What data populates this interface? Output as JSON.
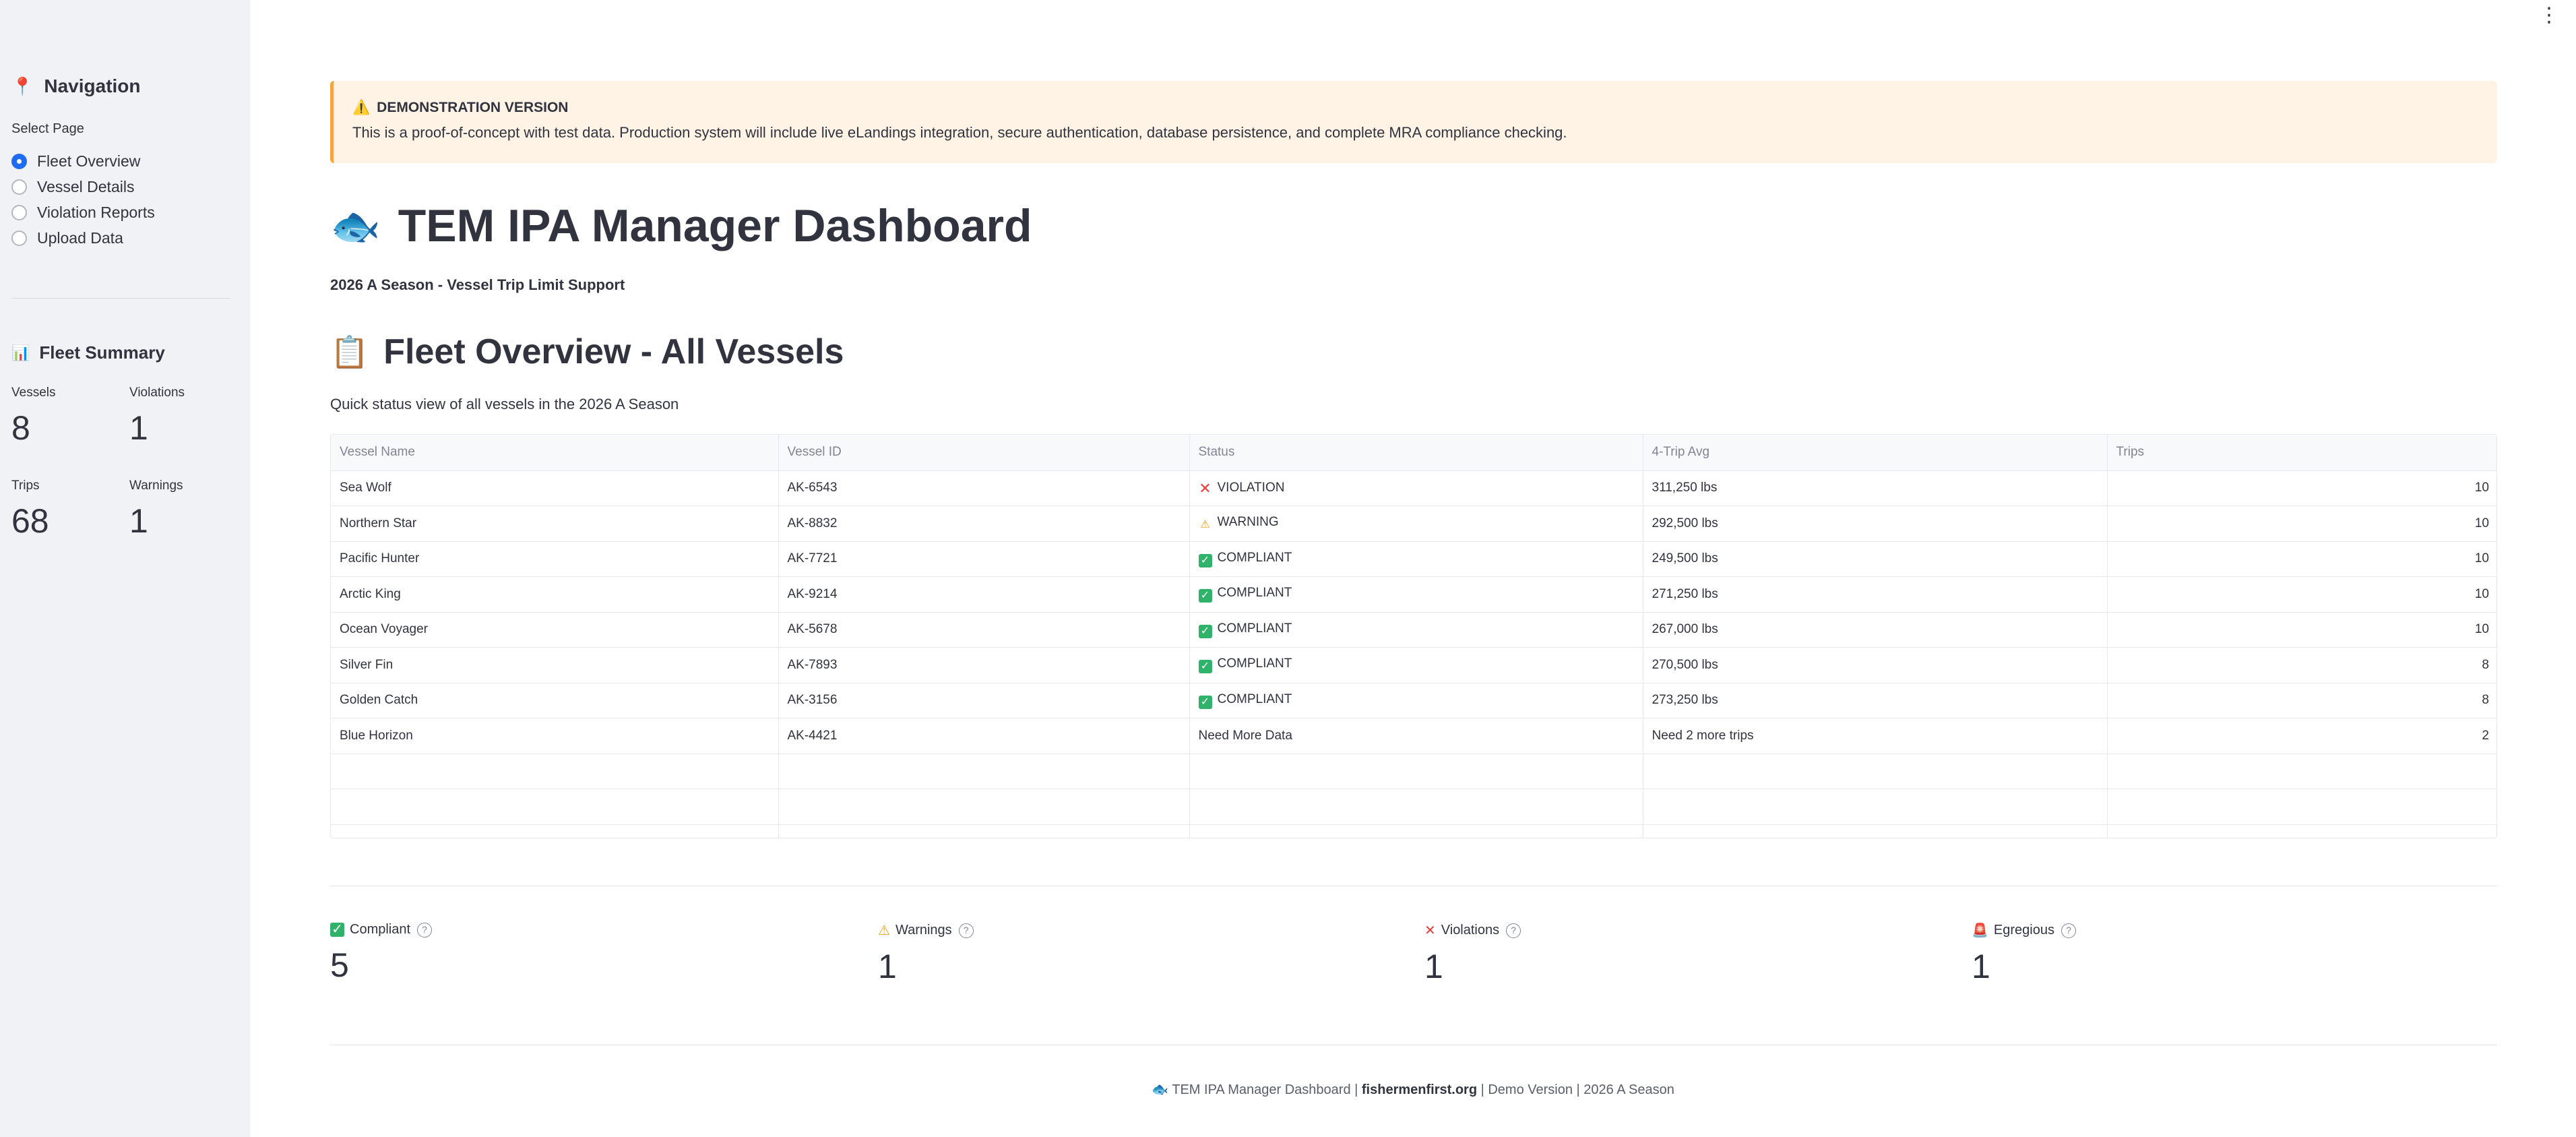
{
  "sidebar": {
    "nav_heading": "Navigation",
    "nav_icon": "pin-icon",
    "select_label": "Select Page",
    "pages": [
      {
        "label": "Fleet Overview",
        "selected": true
      },
      {
        "label": "Vessel Details",
        "selected": false
      },
      {
        "label": "Violation Reports",
        "selected": false
      },
      {
        "label": "Upload Data",
        "selected": false
      }
    ],
    "summary_heading": "Fleet Summary",
    "summary_icon": "bar-chart-icon",
    "metrics": {
      "vessels_label": "Vessels",
      "vessels_value": "8",
      "violations_label": "Violations",
      "violations_value": "1",
      "trips_label": "Trips",
      "trips_value": "68",
      "warnings_label": "Warnings",
      "warnings_value": "1"
    }
  },
  "banner": {
    "title": "DEMONSTRATION VERSION",
    "text": "This is a proof-of-concept with test data. Production system will include live eLandings integration, secure authentication, database persistence, and complete MRA compliance checking."
  },
  "header": {
    "title": "TEM IPA Manager Dashboard",
    "subtitle": "2026 A Season - Vessel Trip Limit Support"
  },
  "section": {
    "title": "Fleet Overview - All Vessels",
    "caption": "Quick status view of all vessels in the 2026 A Season"
  },
  "table": {
    "columns": [
      "Vessel Name",
      "Vessel ID",
      "Status",
      "4-Trip Avg",
      "Trips"
    ],
    "rows": [
      {
        "name": "Sea Wolf",
        "id": "AK-6543",
        "status": "VIOLATION",
        "status_icon": "x-icon",
        "avg": "311,250 lbs",
        "trips": "10"
      },
      {
        "name": "Northern Star",
        "id": "AK-8832",
        "status": "WARNING",
        "status_icon": "warning-icon",
        "avg": "292,500 lbs",
        "trips": "10"
      },
      {
        "name": "Pacific Hunter",
        "id": "AK-7721",
        "status": "COMPLIANT",
        "status_icon": "check-icon",
        "avg": "249,500 lbs",
        "trips": "10"
      },
      {
        "name": "Arctic King",
        "id": "AK-9214",
        "status": "COMPLIANT",
        "status_icon": "check-icon",
        "avg": "271,250 lbs",
        "trips": "10"
      },
      {
        "name": "Ocean Voyager",
        "id": "AK-5678",
        "status": "COMPLIANT",
        "status_icon": "check-icon",
        "avg": "267,000 lbs",
        "trips": "10"
      },
      {
        "name": "Silver Fin",
        "id": "AK-7893",
        "status": "COMPLIANT",
        "status_icon": "check-icon",
        "avg": "270,500 lbs",
        "trips": "8"
      },
      {
        "name": "Golden Catch",
        "id": "AK-3156",
        "status": "COMPLIANT",
        "status_icon": "check-icon",
        "avg": "273,250 lbs",
        "trips": "8"
      },
      {
        "name": "Blue Horizon",
        "id": "AK-4421",
        "status": "Need More Data",
        "status_icon": "",
        "avg": "Need 2 more trips",
        "trips": "2"
      }
    ]
  },
  "metrics": {
    "compliant_label": "Compliant",
    "compliant_value": "5",
    "warnings_label": "Warnings",
    "warnings_value": "1",
    "violations_label": "Violations",
    "violations_value": "1",
    "egregious_label": "Egregious",
    "egregious_value": "1"
  },
  "footer": {
    "prefix": "TEM IPA Manager Dashboard |",
    "link": "fishermenfirst.org",
    "suffix": "| Demo Version | 2026 A Season"
  },
  "colors": {
    "sidebar_bg": "#f0f2f6",
    "banner_bg": "#fff3e6",
    "accent": "#1f6cf0",
    "compliant": "#2fb36b",
    "violation": "#e23b3b",
    "warning": "#f0a020"
  }
}
